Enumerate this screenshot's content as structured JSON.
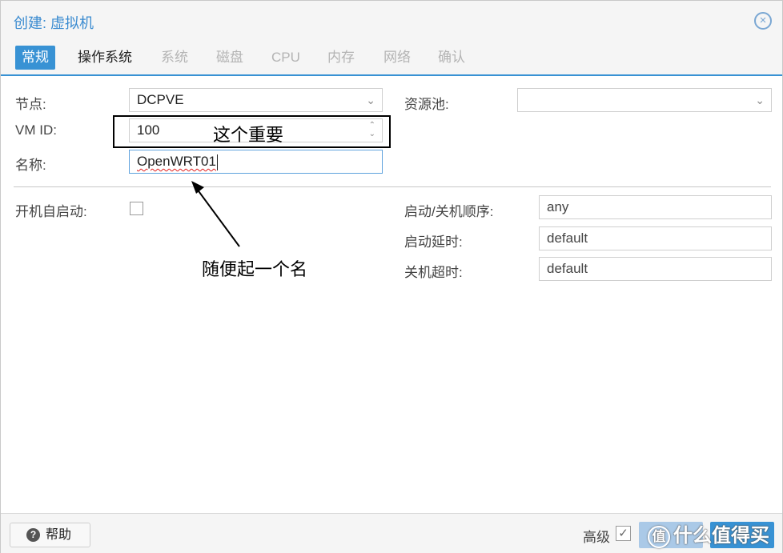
{
  "window": {
    "title": "创建: 虚拟机",
    "close_icon": "×"
  },
  "tabs": [
    {
      "label": "常规",
      "state": "active"
    },
    {
      "label": "操作系统",
      "state": "enabled"
    },
    {
      "label": "系统",
      "state": "disabled"
    },
    {
      "label": "磁盘",
      "state": "disabled"
    },
    {
      "label": "CPU",
      "state": "disabled"
    },
    {
      "label": "内存",
      "state": "disabled"
    },
    {
      "label": "网络",
      "state": "disabled"
    },
    {
      "label": "确认",
      "state": "disabled"
    }
  ],
  "form": {
    "node_label": "节点:",
    "node_value": "DCPVE",
    "pool_label": "资源池:",
    "pool_value": "",
    "vmid_label": "VM ID:",
    "vmid_value": "100",
    "name_label": "名称:",
    "name_value": "OpenWRT01",
    "onboot_label": "开机自启动:",
    "onboot_checked": false,
    "order_label": "启动/关机顺序:",
    "order_value": "any",
    "startup_delay_label": "启动延时:",
    "startup_delay_value": "default",
    "shutdown_timeout_label": "关机超时:",
    "shutdown_timeout_value": "default"
  },
  "annotations": {
    "vmid_note": "这个重要",
    "name_note": "随便起一个名"
  },
  "footer": {
    "help_label": "帮助",
    "advanced_label": "高级",
    "advanced_checked": true
  },
  "watermark": {
    "icon_text": "值",
    "text": "什么值得买"
  },
  "colors": {
    "accent": "#3892d4",
    "title": "#3a8bd0",
    "annotation": "#000000"
  },
  "icons": {
    "close": "close-icon",
    "dropdown": "chevron-down-icon",
    "spinner": "spinner-icon",
    "help": "question-circle-icon",
    "checkmark": "checkmark-icon"
  }
}
